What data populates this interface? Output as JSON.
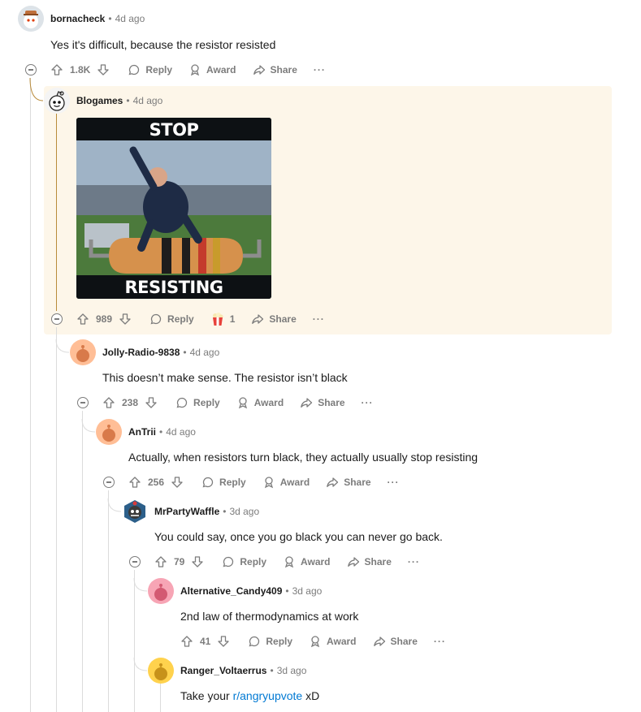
{
  "comments": [
    {
      "username": "bornacheck",
      "age": "4d ago",
      "text": "Yes it's difficult, because the resistor resisted",
      "votes": "1.8K",
      "reply": "Reply",
      "award": "Award",
      "share": "Share",
      "more": "···"
    },
    {
      "username": "Blogames",
      "age": "4d ago",
      "votes": "989",
      "reply": "Reply",
      "award_count": "1",
      "share": "Share",
      "more": "···",
      "image": {
        "top_text": "STOP",
        "bottom_text": "RESISTING"
      }
    },
    {
      "username": "Jolly-Radio-9838",
      "age": "4d ago",
      "text": "This doesn’t make sense. The resistor isn’t black",
      "votes": "238",
      "reply": "Reply",
      "award": "Award",
      "share": "Share",
      "more": "···"
    },
    {
      "username": "AnTrii",
      "age": "4d ago",
      "text": "Actually, when resistors turn black, they actually usually stop resisting",
      "votes": "256",
      "reply": "Reply",
      "award": "Award",
      "share": "Share",
      "more": "···"
    },
    {
      "username": "MrPartyWaffle",
      "age": "3d ago",
      "text": "You could say, once you go black you can never go back.",
      "votes": "79",
      "reply": "Reply",
      "award": "Award",
      "share": "Share",
      "more": "···"
    },
    {
      "username": "Alternative_Candy409",
      "age": "3d ago",
      "text": "2nd law of thermodynamics at work",
      "votes": "41",
      "reply": "Reply",
      "award": "Award",
      "share": "Share",
      "more": "···"
    },
    {
      "username": "Ranger_Voltaerrus",
      "age": "3d ago",
      "text_prefix": "Take your ",
      "link": "r/angryupvote",
      "text_suffix": " xD"
    }
  ],
  "separator": "•",
  "colors": {
    "meta": "#7c7c7c",
    "link": "#0079d3",
    "thread_highlight": "#fdf6e9",
    "thread_gold": "#b98b3a"
  }
}
